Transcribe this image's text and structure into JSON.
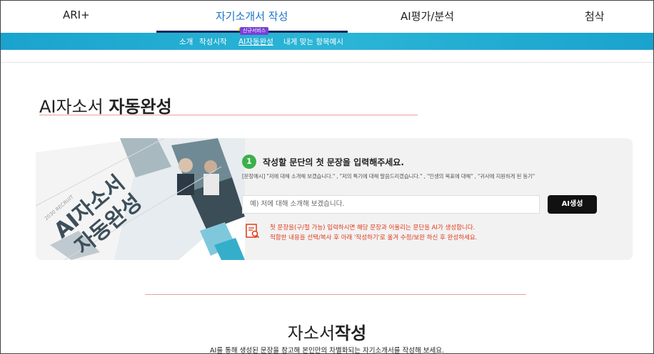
{
  "nav": {
    "items": [
      {
        "label": "ARI+"
      },
      {
        "label": "자기소개서 작성"
      },
      {
        "label": "AI평가/분석"
      },
      {
        "label": "첨삭"
      }
    ]
  },
  "subnav": {
    "items": [
      {
        "label": "소개"
      },
      {
        "label": "작성시작"
      },
      {
        "label": "AI자동완성"
      },
      {
        "label": "내게 맞는 항목예시"
      }
    ],
    "badge": "신규서비스"
  },
  "page": {
    "title_light": "AI자소서 ",
    "title_bold": "자동완성"
  },
  "banner": {
    "small_text": "2030 RECRUIT",
    "line1": "AI자소서",
    "line2": "자동완성"
  },
  "form": {
    "step_number": "1",
    "step_title": "작성할 문단의 첫 문장을 입력해주세요.",
    "example": "[문장예시] \"저에 대해 소개해 보겠습니다.\" , \"저의 특기에 대해 말씀드리겠습니다.\" , \"인생의 목표에 대해\" , \"귀사에 지원하게 된 동기\"",
    "input_placeholder": "예) 저에 대해 소개해 보겠습니다.",
    "generate_label": "AI생성",
    "note_line1": "첫 문장을(구/절 가능) 입력하시면 해당 문장과 어울리는 문단을 AI가 생성합니다.",
    "note_line2": "적합한 내용을 선택/복사 후 아래 '작성하기'로 옮겨 수정/보완 하신 후 완성하세요."
  },
  "section": {
    "title_light": "자소서",
    "title_bold": "작성",
    "desc": "AI를 통해 생성된 문장을 참고해 본인만의 차별화되는 자기소개서를 작성해 보세요."
  },
  "colors": {
    "accent_blue": "#1a73c8",
    "subnav_bg": "#2bb5d6",
    "step_green": "#3bb14a",
    "note_red": "#e03a1c",
    "badge_purple": "#7b3fd6"
  }
}
